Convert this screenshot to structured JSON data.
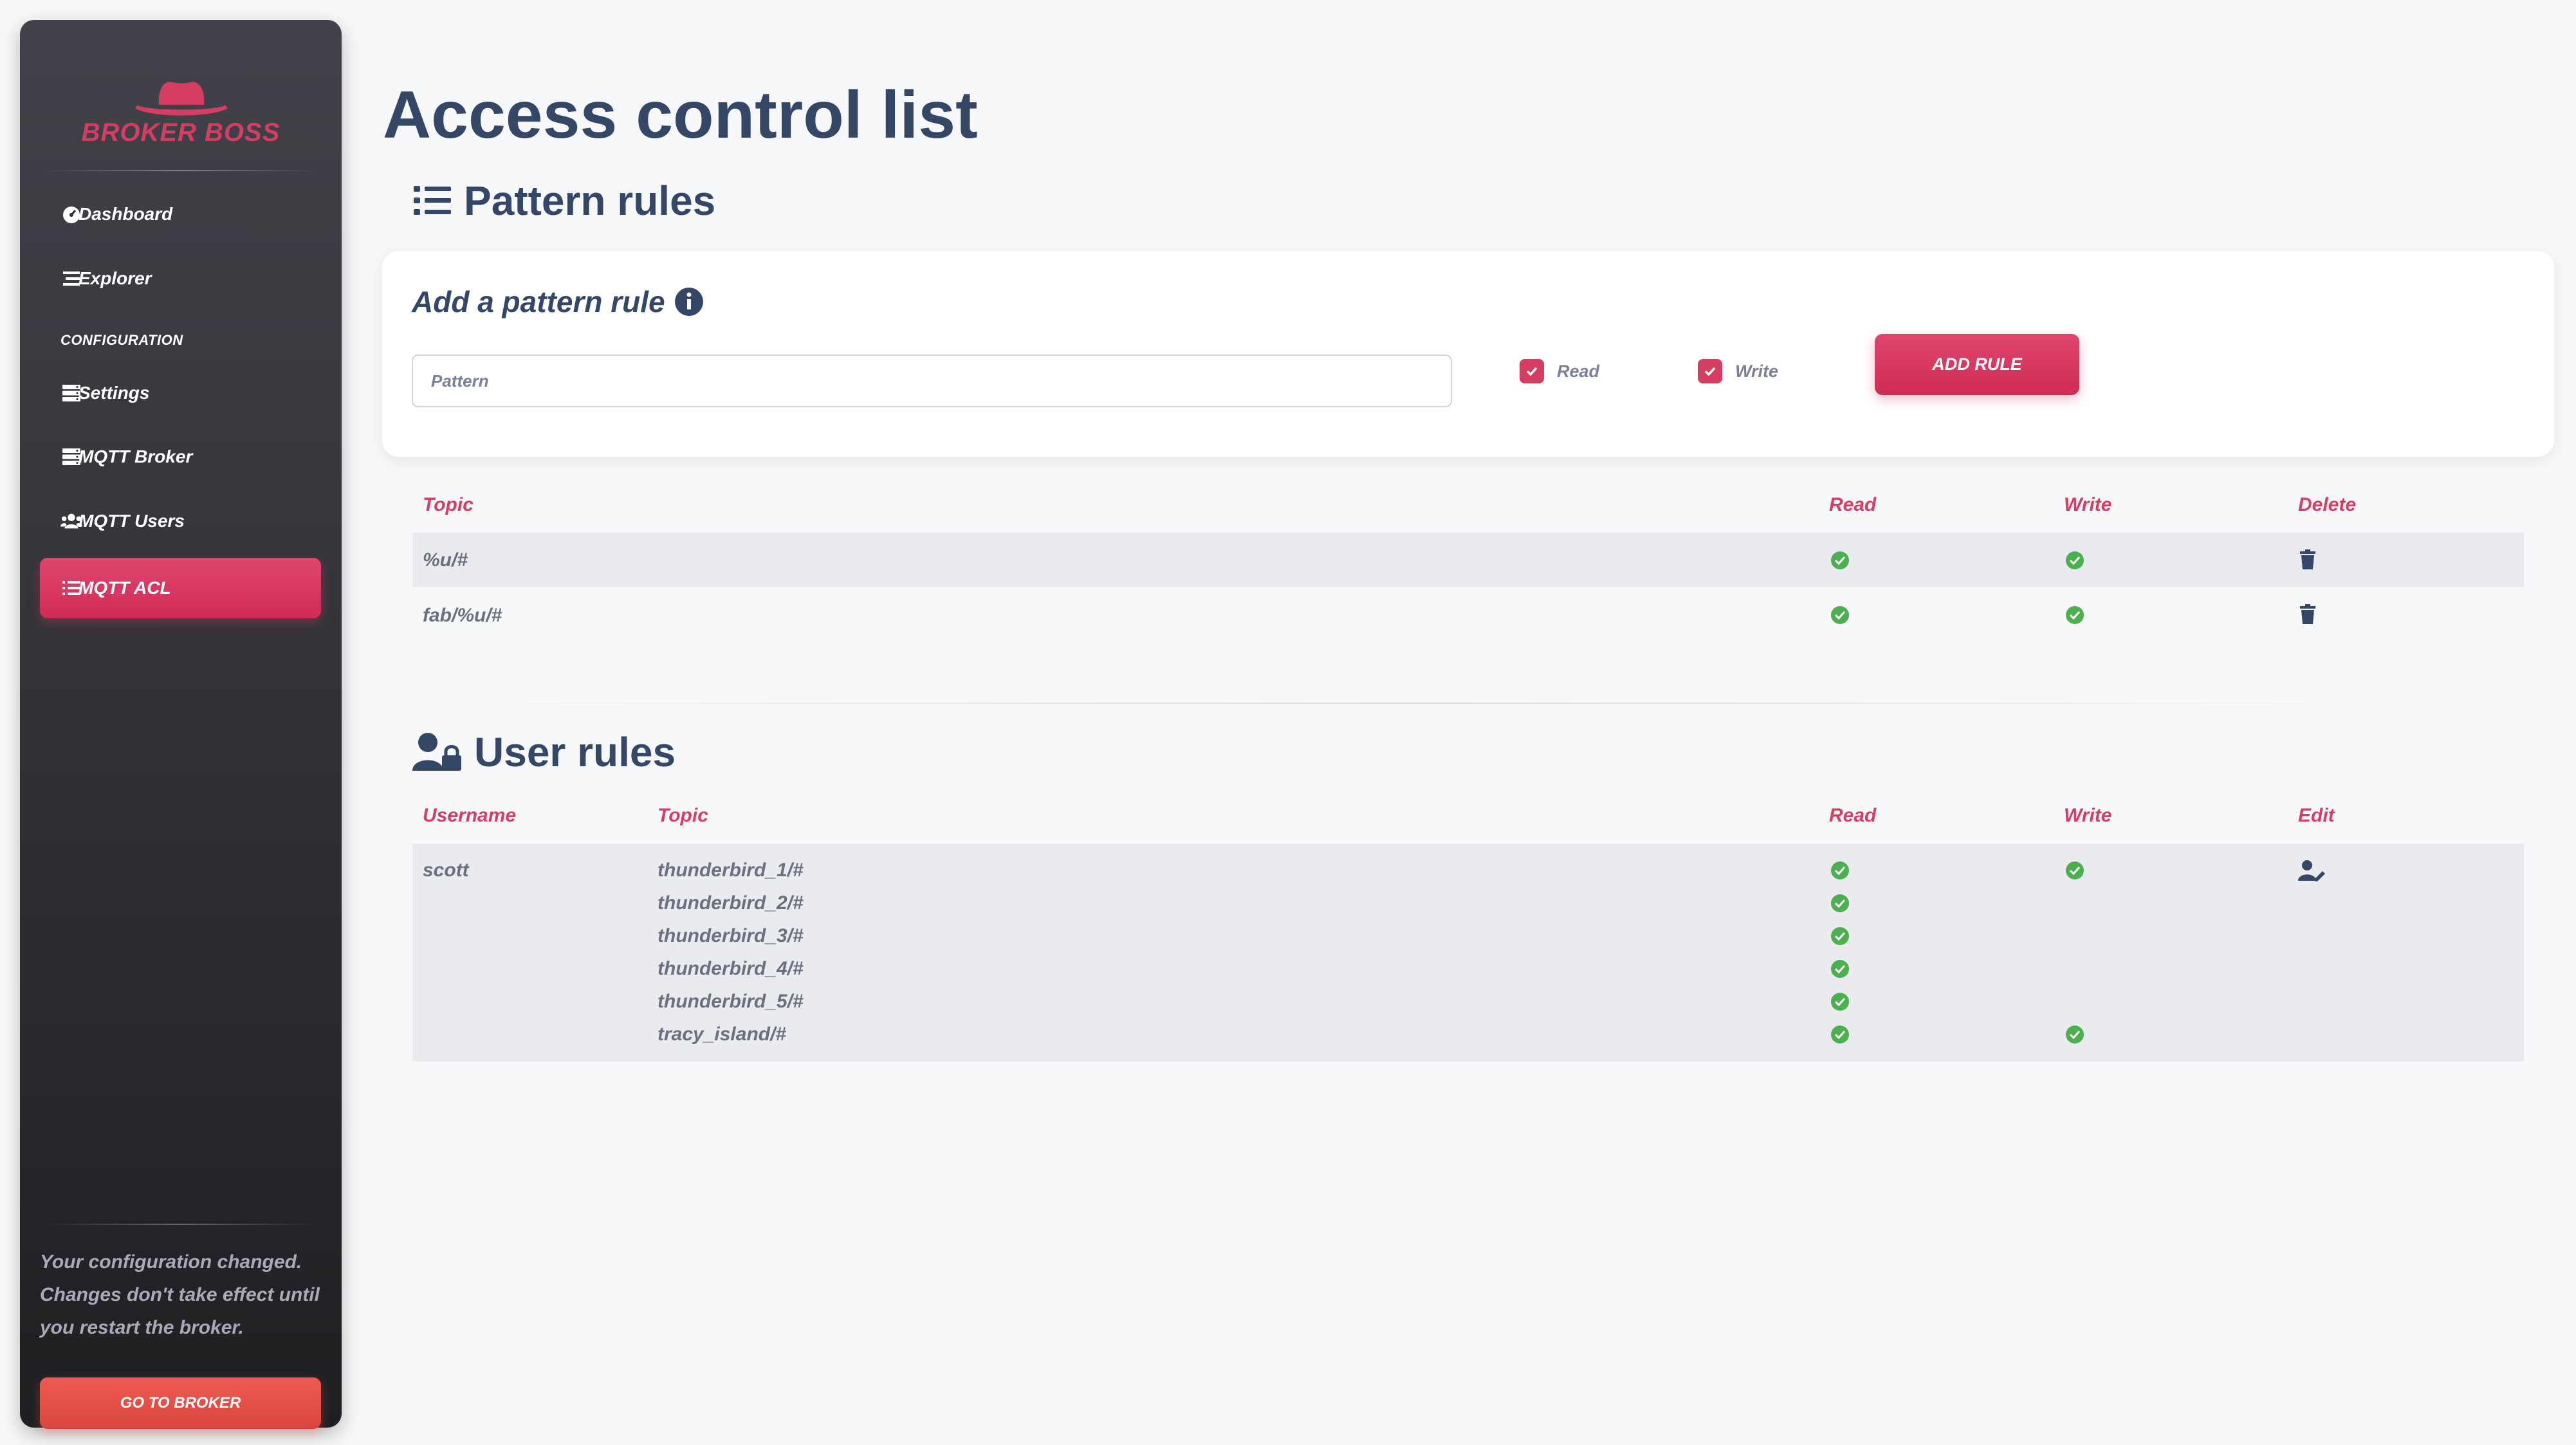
{
  "sidebar": {
    "brand": "BROKER BOSS",
    "items": [
      {
        "label": "Dashboard",
        "icon": "gauge-icon"
      },
      {
        "label": "Explorer",
        "icon": "list-icon"
      },
      {
        "label": "Settings",
        "icon": "server-icon"
      },
      {
        "label": "MQTT Broker",
        "icon": "server-icon"
      },
      {
        "label": "MQTT Users",
        "icon": "users-icon"
      },
      {
        "label": "MQTT ACL",
        "icon": "list-ul-icon"
      }
    ],
    "section_label": "CONFIGURATION",
    "notice": "Your configuration changed. Changes don't take effect until you restart the broker.",
    "go_broker_label": "GO TO BROKER"
  },
  "page": {
    "title": "Access control list"
  },
  "pattern_rules": {
    "heading": "Pattern rules",
    "form": {
      "title": "Add a pattern rule",
      "pattern_placeholder": "Pattern",
      "read_label": "Read",
      "write_label": "Write",
      "read_checked": true,
      "write_checked": true,
      "add_label": "ADD RULE"
    },
    "columns": {
      "topic": "Topic",
      "read": "Read",
      "write": "Write",
      "delete": "Delete"
    },
    "rows": [
      {
        "topic": "%u/#",
        "read": true,
        "write": true
      },
      {
        "topic": "fab/%u/#",
        "read": true,
        "write": true
      }
    ]
  },
  "user_rules": {
    "heading": "User rules",
    "columns": {
      "username": "Username",
      "topic": "Topic",
      "read": "Read",
      "write": "Write",
      "edit": "Edit"
    },
    "users": [
      {
        "username": "scott",
        "topics": [
          {
            "topic": "thunderbird_1/#",
            "read": true,
            "write": true
          },
          {
            "topic": "thunderbird_2/#",
            "read": true,
            "write": false
          },
          {
            "topic": "thunderbird_3/#",
            "read": true,
            "write": false
          },
          {
            "topic": "thunderbird_4/#",
            "read": true,
            "write": false
          },
          {
            "topic": "thunderbird_5/#",
            "read": true,
            "write": false
          },
          {
            "topic": "tracy_island/#",
            "read": true,
            "write": true
          }
        ]
      }
    ]
  },
  "colors": {
    "accent": "#d63d62",
    "success": "#4caf50",
    "text_dark": "#344767"
  }
}
